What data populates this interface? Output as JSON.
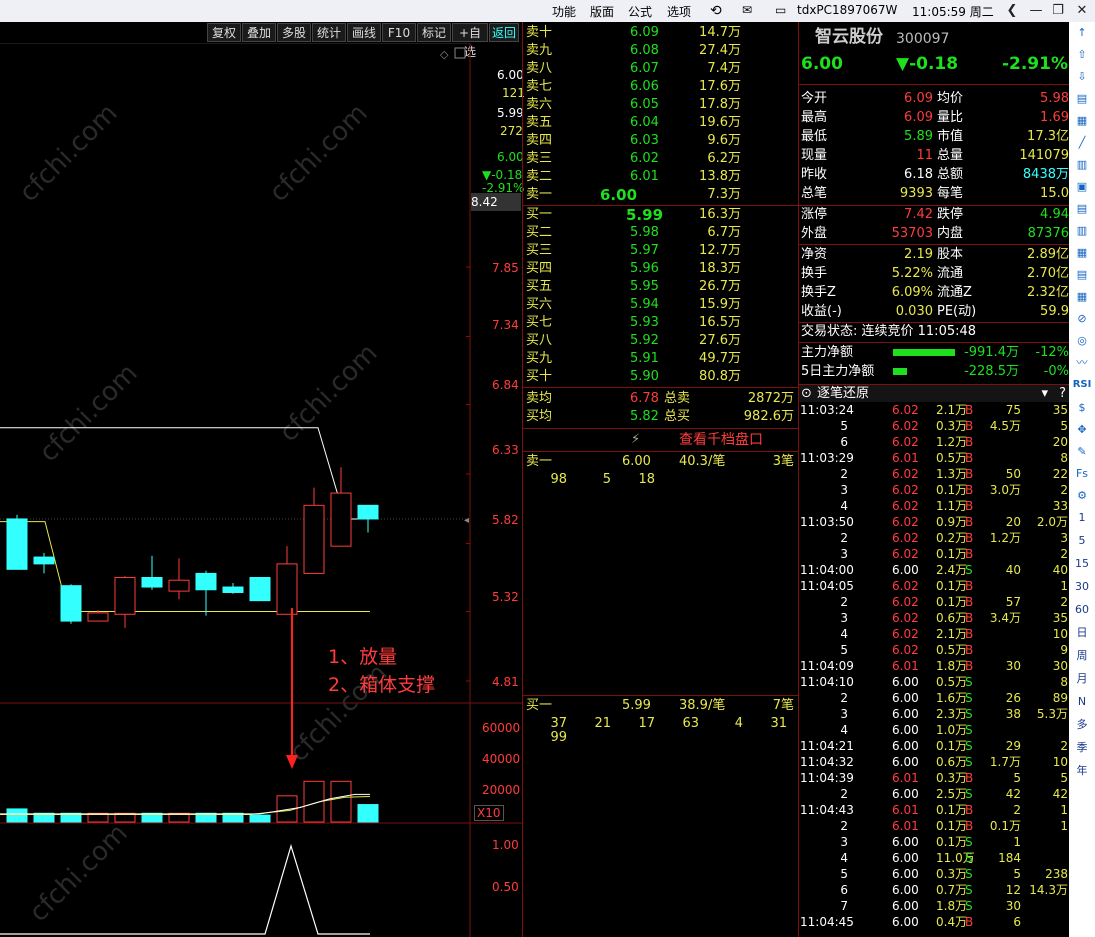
{
  "titlebar": {
    "menu": [
      "功能",
      "版面",
      "公式",
      "选项"
    ],
    "pc": "tdxPC1897067W",
    "time": "11:05:59 周二"
  },
  "chart_toolbar": [
    "复权",
    "叠加",
    "多股",
    "统计",
    "画线",
    "F10",
    "标记",
    "+自选",
    "返回"
  ],
  "price_axis": {
    "labels": [
      "7.85",
      "7.34",
      "6.84",
      "6.33",
      "5.82",
      "5.32",
      "4.81"
    ],
    "badge": "8.42",
    "top_info": [
      "6.00",
      "121",
      "5.99",
      "272",
      "6.00",
      "▼-0.18",
      "-2.91%"
    ]
  },
  "vol_axis": {
    "labels": [
      "60000",
      "40000",
      "20000"
    ],
    "unit": "X10"
  },
  "ind_axis": {
    "labels": [
      "1.00",
      "0.50"
    ]
  },
  "annotation": {
    "line1": "1、放量",
    "line2": "2、箱体支撑"
  },
  "chart_data": {
    "type": "candlestick",
    "candles": [
      {
        "o": 6.0,
        "c": 5.63,
        "h": 6.03,
        "l": 5.63
      },
      {
        "o": 5.72,
        "c": 5.67,
        "h": 5.75,
        "l": 5.6
      },
      {
        "o": 5.51,
        "c": 5.25,
        "h": 5.52,
        "l": 5.23
      },
      {
        "o": 5.25,
        "c": 5.31,
        "h": 5.33,
        "l": 5.25
      },
      {
        "o": 5.3,
        "c": 5.57,
        "h": 5.58,
        "l": 5.2
      },
      {
        "o": 5.57,
        "c": 5.5,
        "h": 5.73,
        "l": 5.48
      },
      {
        "o": 5.47,
        "c": 5.55,
        "h": 5.71,
        "l": 5.41
      },
      {
        "o": 5.6,
        "c": 5.48,
        "h": 5.62,
        "l": 5.29
      },
      {
        "o": 5.5,
        "c": 5.46,
        "h": 5.53,
        "l": 5.45
      },
      {
        "o": 5.57,
        "c": 5.4,
        "h": 5.57,
        "l": 5.4
      },
      {
        "o": 5.3,
        "c": 5.67,
        "h": 5.8,
        "l": 5.3
      },
      {
        "o": 5.6,
        "c": 6.1,
        "h": 6.23,
        "l": 5.6
      },
      {
        "o": 5.8,
        "c": 6.19,
        "h": 6.38,
        "l": 5.8
      },
      {
        "o": 6.1,
        "c": 6.0,
        "h": 6.1,
        "l": 5.9
      }
    ],
    "volumes": [
      9000,
      6000,
      6000,
      6000,
      6000,
      6000,
      6000,
      6000,
      6000,
      4700,
      18000,
      28000,
      28000,
      12000
    ]
  },
  "orderbook": {
    "sells": [
      [
        "卖十",
        "6.09",
        "14.7万"
      ],
      [
        "卖九",
        "6.08",
        "27.4万"
      ],
      [
        "卖八",
        "6.07",
        "7.4万"
      ],
      [
        "卖七",
        "6.06",
        "17.6万"
      ],
      [
        "卖六",
        "6.05",
        "17.8万"
      ],
      [
        "卖五",
        "6.04",
        "19.6万"
      ],
      [
        "卖四",
        "6.03",
        "9.6万"
      ],
      [
        "卖三",
        "6.02",
        "6.2万"
      ],
      [
        "卖二",
        "6.01",
        "13.8万"
      ],
      [
        "卖一",
        "6.00",
        "7.3万"
      ]
    ],
    "buys": [
      [
        "买一",
        "5.99",
        "16.3万"
      ],
      [
        "买二",
        "5.98",
        "6.7万"
      ],
      [
        "买三",
        "5.97",
        "12.7万"
      ],
      [
        "买四",
        "5.96",
        "18.3万"
      ],
      [
        "买五",
        "5.95",
        "26.7万"
      ],
      [
        "买六",
        "5.94",
        "15.9万"
      ],
      [
        "买七",
        "5.93",
        "16.5万"
      ],
      [
        "买八",
        "5.92",
        "27.6万"
      ],
      [
        "买九",
        "5.91",
        "49.7万"
      ],
      [
        "买十",
        "5.90",
        "80.8万"
      ]
    ],
    "sell_avg": [
      "卖均",
      "6.78",
      "总卖",
      "2872万"
    ],
    "buy_avg": [
      "买均",
      "5.82",
      "总买",
      "982.6万"
    ],
    "link": "查看千档盘口",
    "sell1_queue": {
      "label": "卖一",
      "price": "6.00",
      "avg": "40.3/笔",
      "count": "3笔",
      "items": [
        "98",
        "5",
        "18"
      ]
    },
    "buy1_queue": {
      "label": "买一",
      "price": "5.99",
      "avg": "38.9/笔",
      "count": "7笔",
      "items": [
        "37",
        "21",
        "17",
        "63",
        "4",
        "31",
        "99"
      ]
    }
  },
  "quote": {
    "name": "智云股份",
    "code": "300097",
    "price": "6.00",
    "change": "▼-0.18",
    "pct": "-2.91%",
    "rows1": [
      [
        "今开",
        "6.09",
        "均价",
        "5.98"
      ],
      [
        "最高",
        "6.09",
        "量比",
        "1.69"
      ],
      [
        "最低",
        "5.89",
        "市值",
        "17.3亿"
      ],
      [
        "现量",
        "11",
        "总量",
        "141079"
      ],
      [
        "昨收",
        "6.18",
        "总额",
        "8438万"
      ],
      [
        "总笔",
        "9393",
        "每笔",
        "15.0"
      ]
    ],
    "rows2": [
      [
        "涨停",
        "7.42",
        "跌停",
        "4.94"
      ],
      [
        "外盘",
        "53703",
        "内盘",
        "87376"
      ]
    ],
    "rows3": [
      [
        "净资",
        "2.19",
        "股本",
        "2.89亿"
      ],
      [
        "换手",
        "5.22%",
        "流通",
        "2.70亿"
      ],
      [
        "换手Z",
        "6.09%",
        "流通Z",
        "2.32亿"
      ],
      [
        "收益(-)",
        "0.030",
        "PE(动)",
        "59.9"
      ]
    ],
    "status": "交易状态: 连续竞价 11:05:48",
    "flow1": [
      "主力净额",
      "-991.4万",
      "-12%"
    ],
    "flow2": [
      "5日主力净额",
      "-228.5万",
      "-0%"
    ],
    "ticks_title": "逐笔还原"
  },
  "ticks": [
    [
      "11:03:24",
      "6.02",
      "2.1万",
      "B",
      "75",
      "35"
    ],
    [
      "5",
      "6.02",
      "0.3万",
      "B",
      "4.5万",
      "5"
    ],
    [
      "6",
      "6.02",
      "1.2万",
      "B",
      "",
      "20"
    ],
    [
      "11:03:29",
      "6.01",
      "0.5万",
      "B",
      "",
      "8"
    ],
    [
      "2",
      "6.02",
      "1.3万",
      "B",
      "50",
      "22"
    ],
    [
      "3",
      "6.02",
      "0.1万",
      "B",
      "3.0万",
      "2"
    ],
    [
      "4",
      "6.02",
      "1.1万",
      "B",
      "",
      "33"
    ],
    [
      "11:03:50",
      "6.02",
      "0.9万",
      "B",
      "20",
      "2.0万"
    ],
    [
      "2",
      "6.02",
      "0.2万",
      "B",
      "1.2万",
      "3"
    ],
    [
      "3",
      "6.02",
      "0.1万",
      "B",
      "",
      "2"
    ],
    [
      "11:04:00",
      "6.00",
      "2.4万",
      "S",
      "40",
      "40"
    ],
    [
      "11:04:05",
      "6.02",
      "0.1万",
      "B",
      "",
      "1"
    ],
    [
      "2",
      "6.02",
      "0.1万",
      "B",
      "57",
      "2"
    ],
    [
      "3",
      "6.02",
      "0.6万",
      "B",
      "3.4万",
      "35"
    ],
    [
      "4",
      "6.02",
      "2.1万",
      "B",
      "",
      "10"
    ],
    [
      "5",
      "6.02",
      "0.5万",
      "B",
      "",
      "9"
    ],
    [
      "11:04:09",
      "6.01",
      "1.8万",
      "B",
      "30",
      "30"
    ],
    [
      "11:04:10",
      "6.00",
      "0.5万",
      "S",
      "",
      "8"
    ],
    [
      "2",
      "6.00",
      "1.6万",
      "S",
      "26",
      "89"
    ],
    [
      "3",
      "6.00",
      "2.3万",
      "S",
      "38",
      "5.3万"
    ],
    [
      "4",
      "6.00",
      "1.0万",
      "S",
      "",
      ""
    ],
    [
      "11:04:21",
      "6.00",
      "0.1万",
      "S",
      "29",
      "2"
    ],
    [
      "11:04:32",
      "6.00",
      "0.6万",
      "S",
      "1.7万",
      "10"
    ],
    [
      "11:04:39",
      "6.01",
      "0.3万",
      "B",
      "5",
      "5"
    ],
    [
      "2",
      "6.00",
      "2.5万",
      "S",
      "42",
      "42"
    ],
    [
      "11:04:43",
      "6.01",
      "0.1万",
      "B",
      "2",
      "1"
    ],
    [
      "2",
      "6.01",
      "0.1万",
      "B",
      "0.1万",
      "1"
    ],
    [
      "3",
      "6.00",
      "0.1万",
      "S",
      "1",
      ""
    ],
    [
      "4",
      "6.00",
      "11.0万",
      "S",
      "184",
      ""
    ],
    [
      "5",
      "6.00",
      "0.3万",
      "S",
      "5",
      "238"
    ],
    [
      "6",
      "6.00",
      "0.7万",
      "S",
      "12",
      "14.3万"
    ],
    [
      "7",
      "6.00",
      "1.8万",
      "S",
      "30",
      ""
    ],
    [
      "11:04:45",
      "6.00",
      "0.4万",
      "B",
      "6",
      ""
    ]
  ],
  "sidebar": [
    "RSI",
    "1",
    "5",
    "15",
    "30",
    "60",
    "日",
    "周",
    "月",
    "N",
    "多",
    "季",
    "年"
  ]
}
